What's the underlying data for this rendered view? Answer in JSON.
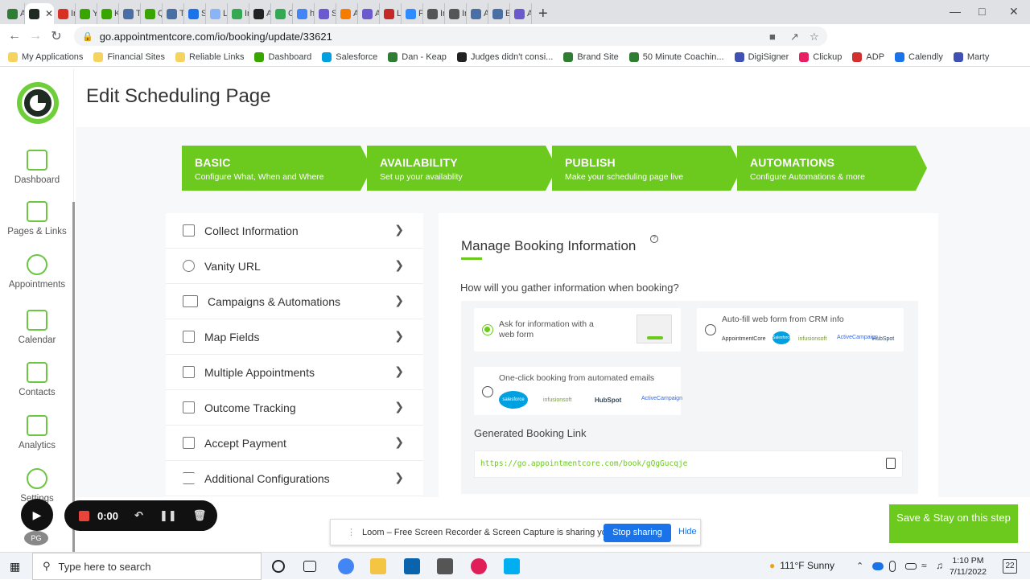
{
  "browser": {
    "tabs": [
      {
        "title": "Ap",
        "icon": "green-k-icon",
        "color": "#2e7d32"
      },
      {
        "title": "",
        "icon": "appointmentcore-icon",
        "color": "#1f2a22",
        "active": true
      },
      {
        "title": "Ini",
        "icon": "gmail-icon",
        "color": "#d93025"
      },
      {
        "title": "Yo",
        "icon": "keap-icon",
        "color": "#38a500"
      },
      {
        "title": "Ke",
        "icon": "keap-icon",
        "color": "#38a500"
      },
      {
        "title": "Th",
        "icon": "doc-icon",
        "color": "#4a6fa5"
      },
      {
        "title": "Qu",
        "icon": "keap-icon",
        "color": "#38a500"
      },
      {
        "title": "Th",
        "icon": "doc-icon",
        "color": "#4a6fa5"
      },
      {
        "title": "Se",
        "icon": "globe-icon",
        "color": "#1a73e8"
      },
      {
        "title": "Le",
        "icon": "spinner-icon",
        "color": "#8ab4f8"
      },
      {
        "title": "Ini",
        "icon": "green-circle-icon",
        "color": "#34a853"
      },
      {
        "title": "Ar",
        "icon": "amazon-icon",
        "color": "#222"
      },
      {
        "title": "Gc",
        "icon": "maps-icon",
        "color": "#34a853"
      },
      {
        "title": "ho",
        "icon": "google-icon",
        "color": "#4285f4"
      },
      {
        "title": "Sl",
        "icon": "purple-star-icon",
        "color": "#6a5acd"
      },
      {
        "title": "Ar",
        "icon": "orange-star-icon",
        "color": "#f57c00"
      },
      {
        "title": "Ar",
        "icon": "purple-star-icon",
        "color": "#6a5acd"
      },
      {
        "title": "Le",
        "icon": "red-circle-icon",
        "color": "#c62828"
      },
      {
        "title": "Pc",
        "icon": "zoom-icon",
        "color": "#2d8cff"
      },
      {
        "title": "Ini",
        "icon": "globe-icon",
        "color": "#555"
      },
      {
        "title": "Ini",
        "icon": "globe-icon",
        "color": "#555"
      },
      {
        "title": "Ap",
        "icon": "doc-icon",
        "color": "#4a6fa5"
      },
      {
        "title": "Ele",
        "icon": "doc-icon",
        "color": "#4a6fa5"
      },
      {
        "title": "Ar",
        "icon": "purple-star-icon",
        "color": "#6a5acd"
      }
    ],
    "url": "go.appointmentcore.com/io/booking/update/33621",
    "bookmarks": [
      {
        "label": "My Applications",
        "color": "#f4d35e"
      },
      {
        "label": "Financial Sites",
        "color": "#f4d35e"
      },
      {
        "label": "Reliable Links",
        "color": "#f4d35e"
      },
      {
        "label": "Dashboard",
        "color": "#38a500"
      },
      {
        "label": "Salesforce",
        "color": "#00a1e0"
      },
      {
        "label": "Dan - Keap",
        "color": "#2e7d32"
      },
      {
        "label": "Judges didn't consi...",
        "color": "#222"
      },
      {
        "label": "Brand Site",
        "color": "#2e7d32"
      },
      {
        "label": "50 Minute Coachin...",
        "color": "#2e7d32"
      },
      {
        "label": "DigiSigner",
        "color": "#3f51b5"
      },
      {
        "label": "Clickup",
        "color": "#e91e63"
      },
      {
        "label": "ADP",
        "color": "#d32f2f"
      },
      {
        "label": "Calendly",
        "color": "#1a73e8"
      },
      {
        "label": "Marty",
        "color": "#3f51b5"
      }
    ]
  },
  "sidebar": {
    "items": [
      {
        "label": "Dashboard"
      },
      {
        "label": "Pages & Links"
      },
      {
        "label": "Appointments"
      },
      {
        "label": "Calendar"
      },
      {
        "label": "Contacts"
      },
      {
        "label": "Analytics"
      },
      {
        "label": "Settings"
      }
    ],
    "avatar": "PG"
  },
  "page": {
    "title": "Edit Scheduling Page"
  },
  "steps": [
    {
      "title": "BASIC",
      "subtitle": "Configure What, When and Where"
    },
    {
      "title": "AVAILABILITY",
      "subtitle": "Set up your availablity"
    },
    {
      "title": "PUBLISH",
      "subtitle": "Make your scheduling page live"
    },
    {
      "title": "AUTOMATIONS",
      "subtitle": "Configure Automations & more"
    }
  ],
  "menu": [
    {
      "label": "Collect Information"
    },
    {
      "label": "Vanity URL"
    },
    {
      "label": "Campaigns & Automations"
    },
    {
      "label": "Map Fields"
    },
    {
      "label": "Multiple Appointments"
    },
    {
      "label": "Outcome Tracking"
    },
    {
      "label": "Accept Payment"
    },
    {
      "label": "Additional Configurations"
    }
  ],
  "panel": {
    "title": "Manage Booking Information",
    "help": "?",
    "question": "How will you gather information when booking?",
    "options": [
      {
        "label": "Ask for information with a web form",
        "selected": true
      },
      {
        "label": "Auto-fill web form from CRM info",
        "selected": false,
        "brands": [
          "AppointmentCore",
          "Salesforce",
          "infusionsoft",
          "ActiveCampaign",
          "HubSpot"
        ]
      },
      {
        "label": "One-click booking from automated emails",
        "selected": false,
        "brands": [
          "salesforce",
          "infusionsoft",
          "HubSpot",
          "ActiveCampaign"
        ]
      }
    ],
    "generated_label": "Generated Booking Link",
    "link": "https://go.appointmentcore.com/book/gQgGucqje"
  },
  "recorder": {
    "time": "0:00"
  },
  "loom": {
    "message": "Loom – Free Screen Recorder & Screen Capture is sharing your screen.",
    "stop": "Stop sharing",
    "hide": "Hide"
  },
  "save_button": "Save & Stay on this step",
  "taskbar": {
    "search_placeholder": "Type here to search",
    "weather": "111°F  Sunny",
    "time": "1:10 PM",
    "date": "7/11/2022",
    "notifications": "22"
  },
  "colors": {
    "accent": "#6cc91d",
    "link": "#1a73e8"
  }
}
